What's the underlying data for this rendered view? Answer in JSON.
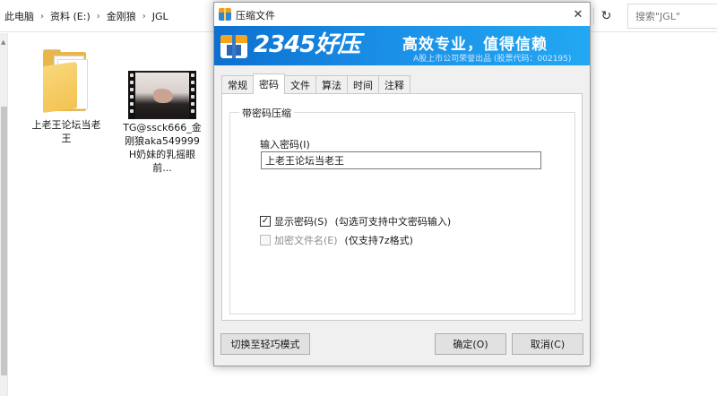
{
  "explorer": {
    "breadcrumb": [
      "此电脑",
      "资料 (E:)",
      "金刚狼",
      "JGL"
    ],
    "search_placeholder": "搜索\"JGL\"",
    "items": [
      {
        "label": "上老王论坛当老王",
        "kind": "folder"
      },
      {
        "label": "TG@ssck666_金刚狼aka549999H奶妹的乳摇眼前...",
        "kind": "video"
      }
    ]
  },
  "dialog": {
    "title": "压缩文件",
    "banner": {
      "brand": "2345好压",
      "slogan": "高效专业，值得信赖",
      "subtitle": "A股上市公司荣誉出品 (股票代码：002195)"
    },
    "tabs": [
      "常规",
      "密码",
      "文件",
      "算法",
      "时间",
      "注释"
    ],
    "active_tab": "密码",
    "group_title": "带密码压缩",
    "password_label": "输入密码(I)",
    "password_value": "上老王论坛当老王",
    "show_password": {
      "label": "显示密码(S)",
      "note": "(勾选可支持中文密码输入)",
      "checked": true
    },
    "encrypt_names": {
      "label": "加密文件名(E)",
      "note": "(仅支持7z格式)",
      "checked": false,
      "disabled": true
    },
    "buttons": {
      "lite_mode": "切换至轻巧模式",
      "ok": "确定(O)",
      "cancel": "取消(C)"
    }
  }
}
